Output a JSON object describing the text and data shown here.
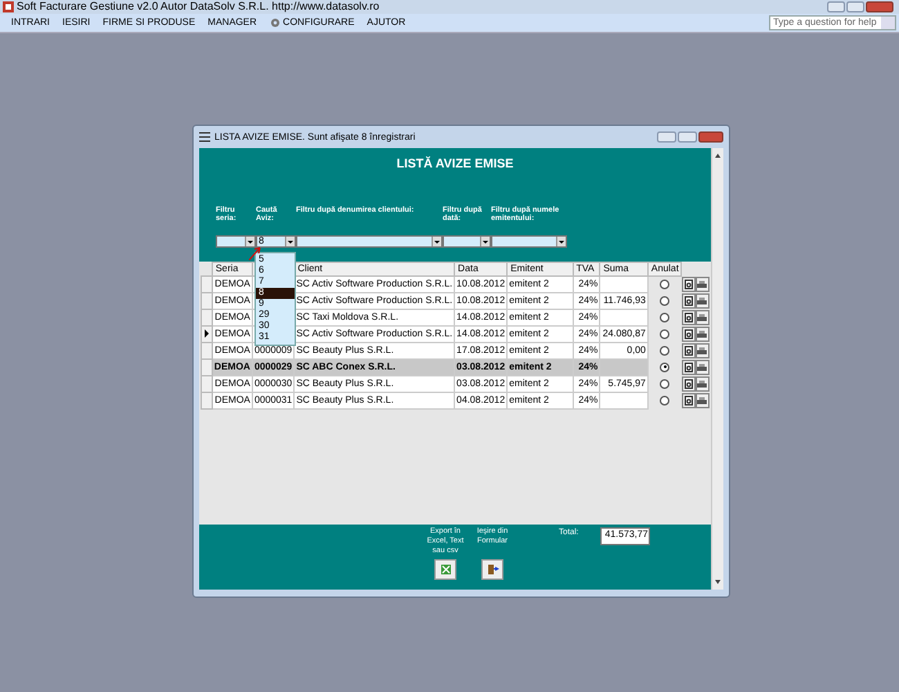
{
  "app": {
    "title": "Soft Facturare Gestiune v2.0 Autor DataSolv S.R.L. http://www.datasolv.ro"
  },
  "menu": [
    {
      "label": "INTRARI",
      "kind": "text"
    },
    {
      "label": "IESIRI",
      "kind": "text"
    },
    {
      "label": "FIRME SI PRODUSE",
      "kind": "text"
    },
    {
      "label": "MANAGER",
      "kind": "text"
    },
    {
      "label": "CONFIGURARE",
      "kind": "icon"
    },
    {
      "label": "AJUTOR",
      "kind": "text"
    }
  ],
  "help": {
    "placeholder": "Type a question for help"
  },
  "window": {
    "title": "LISTA AVIZE EMISE. Sunt afişate 8 înregistrari",
    "heading": "LISTĂ AVIZE EMISE"
  },
  "filters": [
    {
      "label": "Filtru seria:"
    },
    {
      "label": "Caută Aviz:",
      "value": "8"
    },
    {
      "label": "Filtru după denumirea clientului:"
    },
    {
      "label": "Filtru după dată:"
    },
    {
      "label": "Filtru după numele emitentului:"
    }
  ],
  "dropdown": {
    "items": [
      {
        "label": "5",
        "selected": false
      },
      {
        "label": "6",
        "selected": false
      },
      {
        "label": "7",
        "selected": false
      },
      {
        "label": "8",
        "selected": true
      },
      {
        "label": "9",
        "selected": false
      },
      {
        "label": "29",
        "selected": false
      },
      {
        "label": "30",
        "selected": false
      },
      {
        "label": "31",
        "selected": false
      }
    ]
  },
  "table": {
    "columns": [
      "Seria",
      "Client",
      "Data",
      "Emitent",
      "TVA",
      "Suma",
      "Anulat"
    ],
    "rows": [
      {
        "seria": "DEMOA",
        "client": "SC Activ Software Production S.R.L.",
        "data": "10.08.2012",
        "emitent": "emitent 2",
        "tva": "24%",
        "anulat": false,
        "current": false
      },
      {
        "seria": "DEMOA",
        "client": "SC Activ Software Production S.R.L.",
        "data": "10.08.2012",
        "emitent": "emitent 2",
        "tva": "24%",
        "suma": "11.746,93",
        "anulat": false,
        "current": false
      },
      {
        "seria": "DEMOA",
        "client": "SC Taxi Moldova S.R.L.",
        "data": "14.08.2012",
        "emitent": "emitent 2",
        "tva": "24%",
        "anulat": false,
        "current": false
      },
      {
        "seria": "DEMOA",
        "client": "SC Activ Software Production S.R.L.",
        "data": "14.08.2012",
        "emitent": "emitent 2",
        "tva": "24%",
        "suma": "24.080,87",
        "anulat": false,
        "current": true
      },
      {
        "seria": "DEMOA",
        "aviz": "0000009",
        "client": "SC Beauty Plus S.R.L.",
        "data": "17.08.2012",
        "emitent": "emitent 2",
        "tva": "24%",
        "suma": "0,00",
        "anulat": false,
        "current": false
      },
      {
        "seria": "DEMOA",
        "aviz": "0000029",
        "client": "SC ABC Conex S.R.L.",
        "data": "03.08.2012",
        "emitent": "emitent 2",
        "tva": "24%",
        "anulat": true,
        "current": false
      },
      {
        "seria": "DEMOA",
        "aviz": "0000030",
        "client": "SC Beauty Plus S.R.L.",
        "data": "03.08.2012",
        "emitent": "emitent 2",
        "tva": "24%",
        "suma": "5.745,97",
        "anulat": false,
        "current": false
      },
      {
        "seria": "DEMOA",
        "aviz": "0000031",
        "client": "SC Beauty Plus S.R.L.",
        "data": "04.08.2012",
        "emitent": "emitent 2",
        "tva": "24%",
        "anulat": false,
        "current": false
      }
    ]
  },
  "footer": {
    "export_label": "Export în Excel, Text sau csv",
    "exit_label": "Ieşire din Formular",
    "total_label": "Total:",
    "total": "41.573,77"
  }
}
